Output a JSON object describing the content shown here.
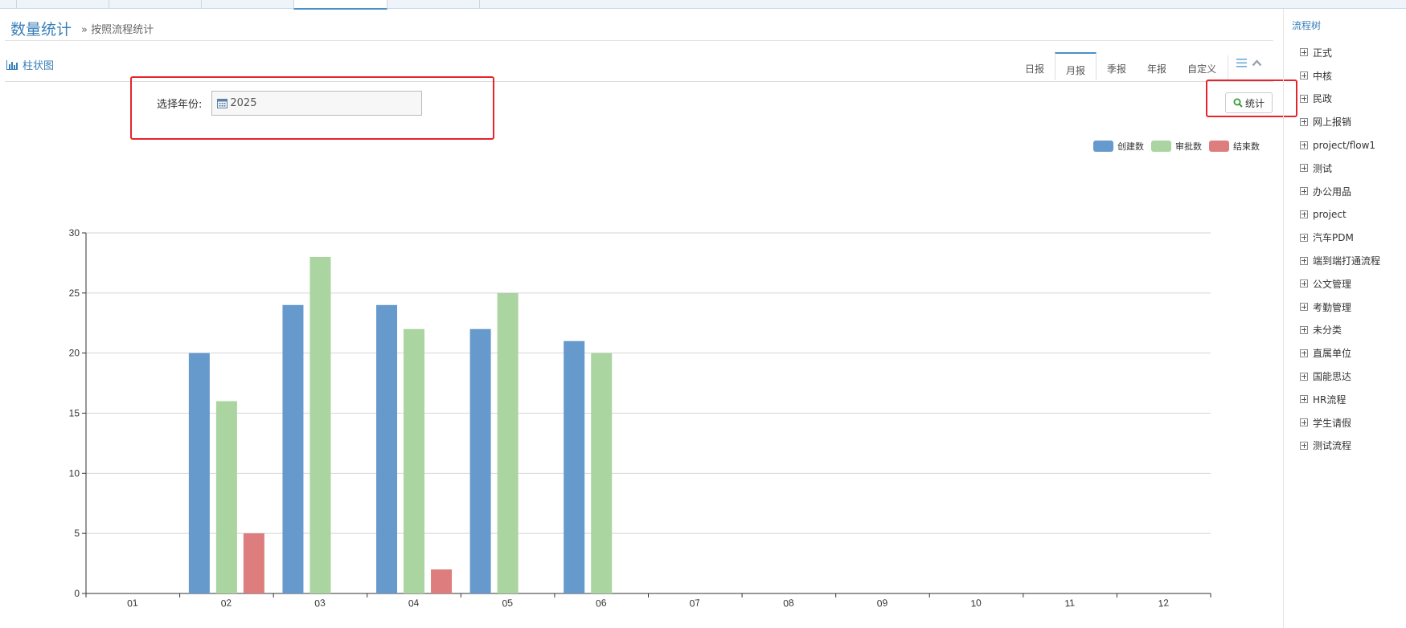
{
  "header": {
    "title": "数量统计",
    "breadcrumb": "» 按照流程统计"
  },
  "chart_panel": {
    "label": "柱状图",
    "icon": "bar-chart-icon"
  },
  "period_tabs": [
    {
      "label": "日报",
      "active": false
    },
    {
      "label": "月报",
      "active": true
    },
    {
      "label": "季报",
      "active": false
    },
    {
      "label": "年报",
      "active": false
    },
    {
      "label": "自定义",
      "active": false
    }
  ],
  "toolbar": {
    "menu_icon": "menu-icon",
    "collapse_icon": "chevron-up-icon"
  },
  "filter": {
    "year_label": "选择年份:",
    "year_value": "2025",
    "input_icon": "calendar-icon"
  },
  "stat_button": {
    "label": "统计",
    "icon": "search-icon"
  },
  "colors": {
    "accent": "#3a7fb8",
    "created": "#6699cc",
    "approved": "#aad4a0",
    "finished": "#dd7d7d",
    "highlight": "#e5242b"
  },
  "chart_data": {
    "type": "bar",
    "categories": [
      "01",
      "02",
      "03",
      "04",
      "05",
      "06",
      "07",
      "08",
      "09",
      "10",
      "11",
      "12"
    ],
    "series": [
      {
        "name": "创建数",
        "color": "#6699cc",
        "values": [
          0,
          20,
          24,
          24,
          22,
          21,
          0,
          0,
          0,
          0,
          0,
          0
        ]
      },
      {
        "name": "审批数",
        "color": "#aad4a0",
        "values": [
          0,
          16,
          28,
          22,
          25,
          20,
          0,
          0,
          0,
          0,
          0,
          0
        ]
      },
      {
        "name": "结束数",
        "color": "#dd7d7d",
        "values": [
          0,
          5,
          0,
          2,
          0,
          0,
          0,
          0,
          0,
          0,
          0,
          0
        ]
      }
    ],
    "ylim": [
      0,
      30
    ],
    "yticks": [
      "0",
      "5",
      "10",
      "15",
      "20",
      "25",
      "30"
    ],
    "grid": true,
    "legend_position": "top-right"
  },
  "sidebar": {
    "title": "流程树",
    "items": [
      "正式",
      "中核",
      "民政",
      "网上报销",
      "project/flow1",
      "测试",
      "办公用品",
      "project",
      "汽车PDM",
      "端到端打通流程",
      "公文管理",
      "考勤管理",
      "未分类",
      "直属单位",
      "国能思达",
      "HR流程",
      "学生请假",
      "测试流程"
    ]
  }
}
